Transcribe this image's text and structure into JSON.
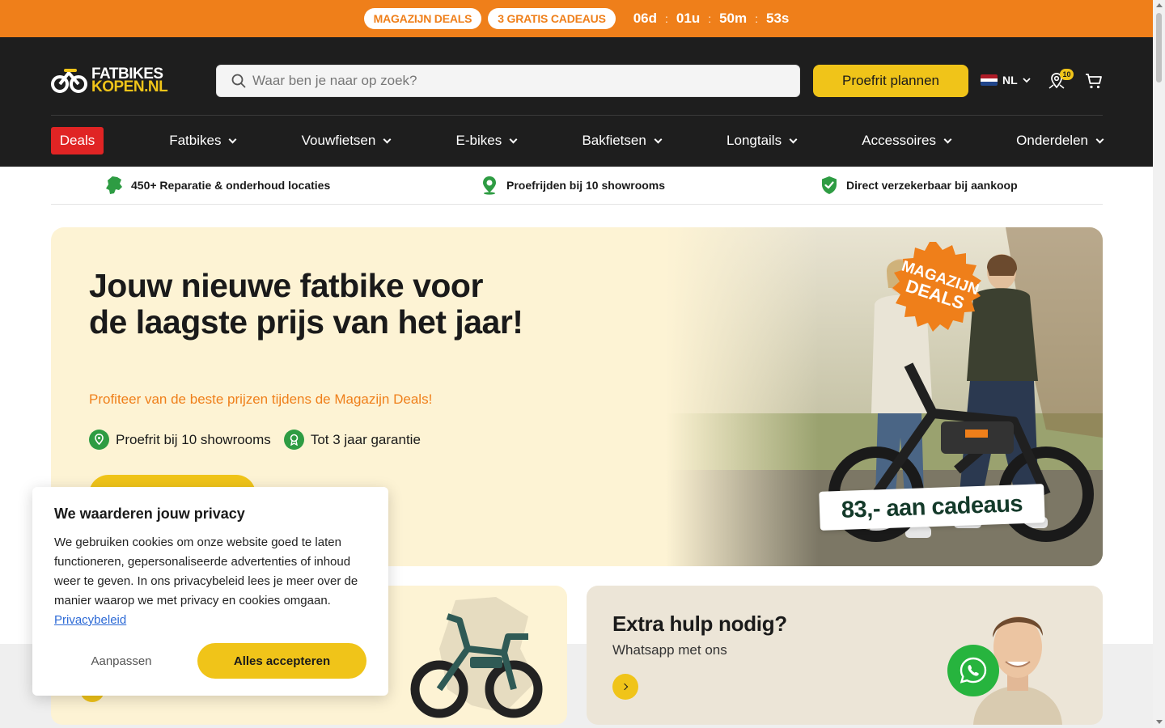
{
  "colors": {
    "promo_orange": "#ef7f1a",
    "header_dark": "#1e1e1e",
    "accent_yellow": "#f0c419",
    "deals_red": "#e02424",
    "usp_green": "#2e9c43",
    "hero_cream": "#fdf3d4"
  },
  "promo": {
    "pills": [
      "MAGAZIJN DEALS",
      "3 GRATIS CADEAUS"
    ],
    "countdown": {
      "days": "06d",
      "hours": "01u",
      "minutes": "50m",
      "seconds": "53s",
      "separator": ":"
    }
  },
  "header": {
    "logo_line1": "FATBIKES",
    "logo_line2": "KOPEN.NL",
    "search_placeholder": "Waar ben je naar op zoek?",
    "proefrit_button": "Proefrit plannen",
    "language": "NL",
    "locations_badge": "10",
    "icons": [
      "search-icon",
      "chevron-down-icon",
      "location-pin-icon",
      "cart-icon"
    ]
  },
  "nav": {
    "deals": "Deals",
    "items": [
      "Fatbikes",
      "Vouwfietsen",
      "E-bikes",
      "Bakfietsen",
      "Longtails",
      "Accessoires",
      "Onderdelen"
    ]
  },
  "usps": [
    {
      "icon": "netherlands-map-icon",
      "text": "450+ Reparatie & onderhoud locaties"
    },
    {
      "icon": "map-pin-icon",
      "text": "Proefrijden bij 10 showrooms"
    },
    {
      "icon": "shield-check-icon",
      "text": "Direct verzekerbaar bij aankoop"
    }
  ],
  "hero": {
    "title": "Jouw nieuwe fatbike voor de laagste prijs van het jaar!",
    "subtitle": "Profiteer van de beste prijzen tijdens de Magazijn Deals!",
    "usps": [
      "Proefrit bij 10 showrooms",
      "Tot 3 jaar garantie"
    ],
    "badge_line1": "MAGAZIJN",
    "badge_line2": "DEALS",
    "gift_label": "83,- aan cadeaus"
  },
  "help_card": {
    "title": "Extra hulp nodig?",
    "subtitle": "Whatsapp met ons"
  },
  "cookie": {
    "title": "We waarderen jouw privacy",
    "body": "We gebruiken cookies om onze website goed te laten functioneren, gepersonaliseerde advertenties of inhoud weer te geven. In ons privacybeleid lees je meer over de manier waarop we met privacy en cookies omgaan.",
    "link": "Privacybeleid",
    "customize_button": "Aanpassen",
    "accept_button": "Alles accepteren"
  }
}
